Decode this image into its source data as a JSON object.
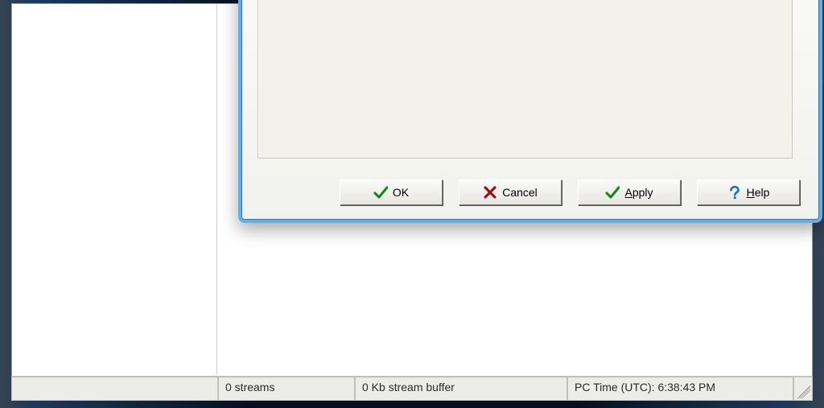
{
  "dialog": {
    "buttons": {
      "ok": "OK",
      "cancel": "Cancel",
      "apply_prefix": "A",
      "apply_rest": "pply",
      "help_prefix": "H",
      "help_rest": "elp"
    }
  },
  "status": {
    "streams": "0 streams",
    "buffer": "0 Kb stream buffer",
    "time": "PC Time (UTC):  6:38:43 PM"
  },
  "colors": {
    "aero_border": "#5aaae6",
    "check_green": "#1e9e1e",
    "x_red": "#c01414",
    "help_blue": "#1f6fc2"
  }
}
